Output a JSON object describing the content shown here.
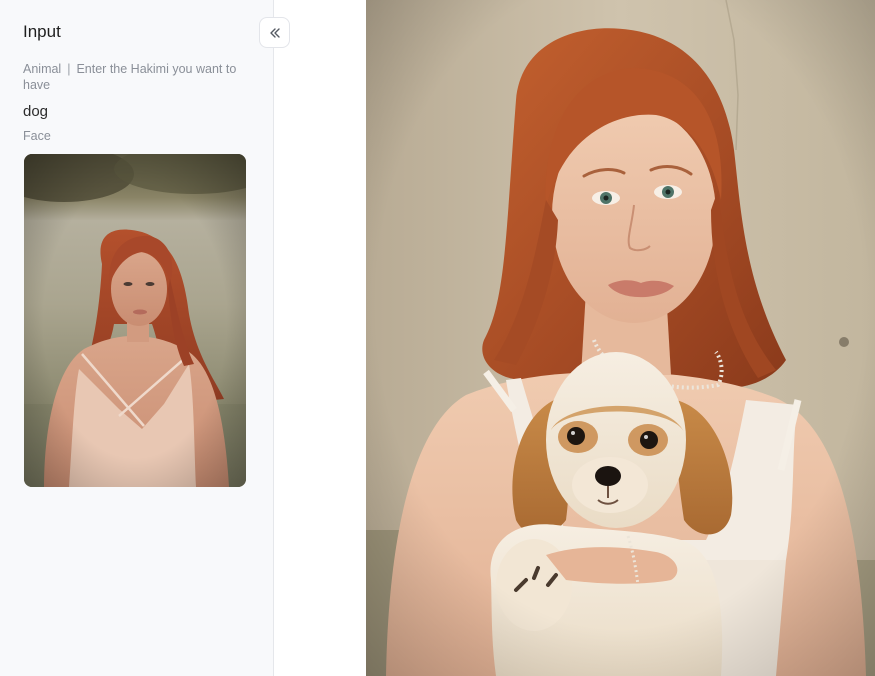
{
  "input_panel": {
    "title": "Input",
    "animal_field": {
      "label": "Animal",
      "separator": "|",
      "hint": "Enter the Hakimi you want to have",
      "value": "dog"
    },
    "face_field": {
      "label": "Face"
    },
    "collapse_icon": "double-chevron-left-icon"
  },
  "colors": {
    "panel_bg": "#f8f9fb",
    "label_gray": "#8a8f98",
    "title_text": "#1f1f1f"
  }
}
